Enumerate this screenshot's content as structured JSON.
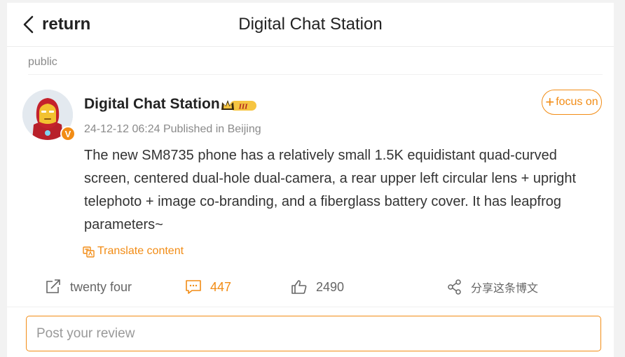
{
  "header": {
    "back_label": "return",
    "title": "Digital Chat Station"
  },
  "section": {
    "label": "public"
  },
  "post": {
    "username": "Digital Chat Station",
    "badge_text": "V",
    "level_text": "III",
    "follow_label": "focus on",
    "meta": "24-12-12 06:24  Published in Beijing",
    "content": "The new SM8735 phone has a relatively small 1.5K equidistant quad-curved screen, centered dual-hole dual-camera, a rear upper left circular lens + upright telephoto + image co-branding, and a fiberglass battery cover. It has leapfrog parameters~",
    "translate_label": "Translate content"
  },
  "actions": {
    "repost_count": "twenty four",
    "comment_count": "447",
    "like_count": "2490",
    "share_label": "分享这条博文"
  },
  "review": {
    "placeholder": "Post your review"
  },
  "colors": {
    "accent": "#f28c15",
    "text": "#333333",
    "muted": "#8a8a8a"
  },
  "icons": [
    "chevron-left-icon",
    "crown-level-icon",
    "translate-icon",
    "repost-icon",
    "comment-icon",
    "like-icon",
    "share-icon"
  ]
}
